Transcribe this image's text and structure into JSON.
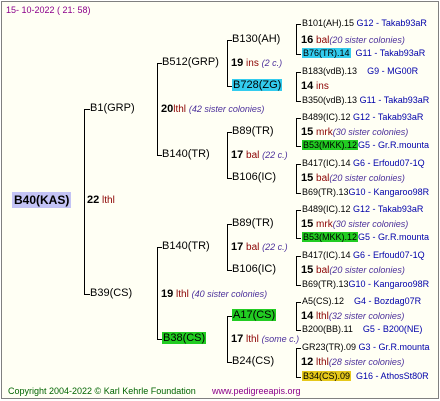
{
  "header": {
    "date": "15- 10-2022 ( 21: 58)"
  },
  "root": {
    "label": "B40(KAS)",
    "gen": "22",
    "unit": "lthl"
  },
  "gen1": [
    {
      "label": "B1(GRP)",
      "gen": "20",
      "unit": "lthl",
      "colonies": "(42 sister colonies)"
    },
    {
      "label": "B39(CS)",
      "gen": "19",
      "unit": "lthl",
      "colonies": "(40 sister colonies)"
    }
  ],
  "gen2": [
    {
      "label": "B512(GRP)",
      "gen": "19",
      "unit": "ins",
      "colonies": "(2 c.)"
    },
    {
      "label": "B140(TR)",
      "gen": "17",
      "unit": "bal",
      "colonies": "(22 c.)"
    },
    {
      "label": "B140(TR)",
      "gen": "17",
      "unit": "bal",
      "colonies": "(22 c.)"
    },
    {
      "label": "B38(CS)",
      "gen": "17",
      "unit": "lthl",
      "colonies": "(some c.)"
    }
  ],
  "gen3": [
    {
      "label": "B130(AH)",
      "gen": "16",
      "unit": "bal",
      "colonies": "(20 sister colonies)"
    },
    {
      "label": "B728(ZG)",
      "gen": "14",
      "unit": "ins",
      "colonies": ""
    },
    {
      "label": "B89(TR)",
      "gen": "15",
      "unit": "mrk",
      "colonies": "(30 sister colonies)"
    },
    {
      "label": "B106(IC)",
      "gen": "15",
      "unit": "bal",
      "colonies": "(20 sister colonies)"
    },
    {
      "label": "B89(TR)",
      "gen": "15",
      "unit": "mrk",
      "colonies": "(30 sister colonies)"
    },
    {
      "label": "B106(IC)",
      "gen": "15",
      "unit": "bal",
      "colonies": "(20 sister colonies)"
    },
    {
      "label": "A17(CS)",
      "gen": "14",
      "unit": "lthl",
      "colonies": "(32 sister colonies)"
    },
    {
      "label": "B24(CS)",
      "gen": "12",
      "unit": "lthl",
      "colonies": "(28 sister colonies)"
    }
  ],
  "leaves": [
    {
      "name": "B101(AH).15",
      "lineage": "G12 - Takab93aR"
    },
    {
      "name": "B76(TR).14",
      "lineage": "G11 - Takab93aR"
    },
    {
      "name": "B183(vdB).13",
      "lineage": "G9 - MG00R"
    },
    {
      "name": "B350(vdB).13",
      "lineage": "G11 - Takab93aR"
    },
    {
      "name": "B489(IC).12",
      "lineage": "G12 - Takab93aR"
    },
    {
      "name": "B53(MKK).12",
      "lineage": "G5 - Gr.R.mounta"
    },
    {
      "name": "B417(IC).14",
      "lineage": "G6 - Erfoud07-1Q"
    },
    {
      "name": "B69(TR).13",
      "lineage": "G10 - Kangaroo98R"
    },
    {
      "name": "B489(IC).12",
      "lineage": "G12 - Takab93aR"
    },
    {
      "name": "B53(MKK).12",
      "lineage": "G5 - Gr.R.mounta"
    },
    {
      "name": "B417(IC).14",
      "lineage": "G6 - Erfoud07-1Q"
    },
    {
      "name": "B69(TR).13",
      "lineage": "G10 - Kangaroo98R"
    },
    {
      "name": "A5(CS).12",
      "lineage": "G4 - Bozdag07R"
    },
    {
      "name": "B200(BB).11",
      "lineage": "G5 - B200(NE)"
    },
    {
      "name": "GR23(TR).09",
      "lineage": "G3 - Gr.R.mounta"
    },
    {
      "name": "B34(CS).09",
      "lineage": "G16 - AthosSt80R"
    }
  ],
  "footer": {
    "copyright": "Copyright 2004-2022 © Karl Kehrle Foundation",
    "site": "www.pedigreeapis.org"
  },
  "colors": {
    "root_highlight": "#c3c3f5",
    "cyan_highlight": "#33ccee",
    "green_highlight": "#22cc22",
    "yellow_highlight": "#e6c81a",
    "unit_color": "#8b0000",
    "lineage_color": "#0000aa"
  }
}
